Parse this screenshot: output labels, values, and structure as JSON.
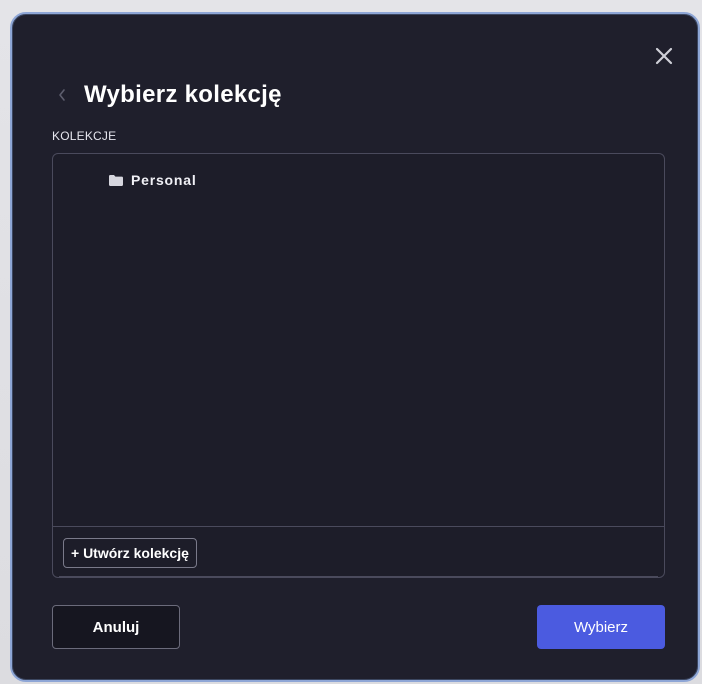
{
  "dialog": {
    "title": "Wybierz kolekcję",
    "close_icon": "close-icon",
    "back_icon": "chevron-left-icon"
  },
  "collections": {
    "section_label": "KOLEKCJE",
    "items": [
      {
        "label": "Personal",
        "icon": "folder-icon"
      }
    ],
    "create_button_label": "+ Utwórz kolekcję"
  },
  "footer": {
    "cancel_label": "Anuluj",
    "select_label": "Wybierz"
  },
  "colors": {
    "dialog_bg": "#1f1f2c",
    "accent": "#4b5be0",
    "border": "#8ea6d6"
  }
}
